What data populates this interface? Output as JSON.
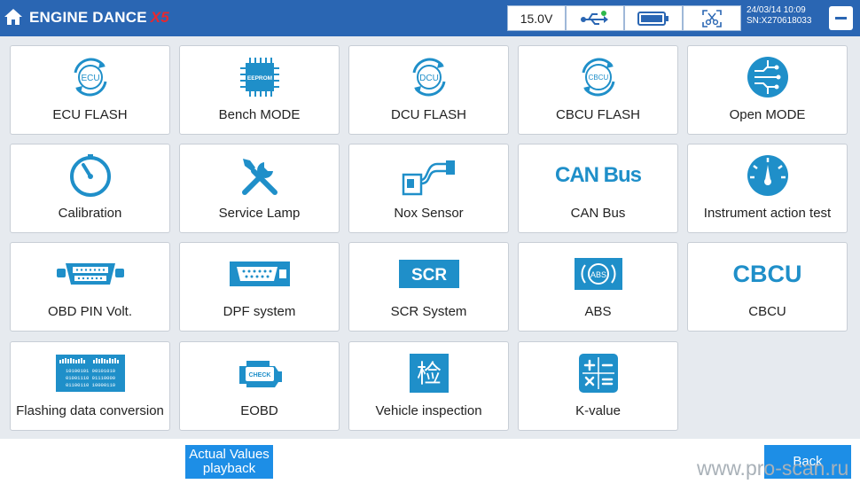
{
  "header": {
    "title": "ENGINE DANCE",
    "title_suffix": "X5",
    "voltage": "15.0V",
    "date_time": "24/03/14 10:09",
    "serial": "SN:X270618033",
    "colors": {
      "bar": "#2a66b3",
      "accent_red": "#e8282e",
      "icon_blue": "#1f8fc9"
    }
  },
  "tiles": [
    {
      "label": "ECU FLASH",
      "icon": "ecu-flash-icon",
      "icon_text": "ECU"
    },
    {
      "label": "Bench MODE",
      "icon": "eeprom-chip-icon",
      "icon_text": "EEPROM"
    },
    {
      "label": "DCU FLASH",
      "icon": "dcu-flash-icon",
      "icon_text": "DCU"
    },
    {
      "label": "CBCU FLASH",
      "icon": "cbcu-flash-icon",
      "icon_text": "CBCU"
    },
    {
      "label": "Open MODE",
      "icon": "circuit-icon"
    },
    {
      "label": "Calibration",
      "icon": "gauge-icon"
    },
    {
      "label": "Service Lamp",
      "icon": "tools-icon"
    },
    {
      "label": "Nox Sensor",
      "icon": "sensor-icon"
    },
    {
      "label": "CAN Bus",
      "icon": "can-bus-icon",
      "icon_text": "CAN Bus"
    },
    {
      "label": "Instrument action test",
      "icon": "speedometer-icon"
    },
    {
      "label": "OBD PIN Volt.",
      "icon": "obd-connector-icon"
    },
    {
      "label": "DPF system",
      "icon": "dpf-connector-icon"
    },
    {
      "label": "SCR System",
      "icon": "scr-icon",
      "icon_text": "SCR"
    },
    {
      "label": "ABS",
      "icon": "abs-icon",
      "icon_text": "ABS"
    },
    {
      "label": "CBCU",
      "icon": "cbcu-icon",
      "icon_text": "CBCU"
    },
    {
      "label": "Flashing data conversion",
      "icon": "binary-data-icon",
      "icon_lines": [
        "10100101 00101010",
        "01001110 01110000",
        "01100110 10000110"
      ]
    },
    {
      "label": "EOBD",
      "icon": "check-engine-icon",
      "icon_text": "CHECK"
    },
    {
      "label": "Vehicle inspection",
      "icon": "inspection-icon",
      "icon_text": "检"
    },
    {
      "label": "K-value",
      "icon": "calculator-icon"
    }
  ],
  "footer": {
    "actual_values_line1": "Actual Values",
    "actual_values_line2": "playback",
    "back": "Back",
    "watermark": "www.pro-scan.ru"
  }
}
